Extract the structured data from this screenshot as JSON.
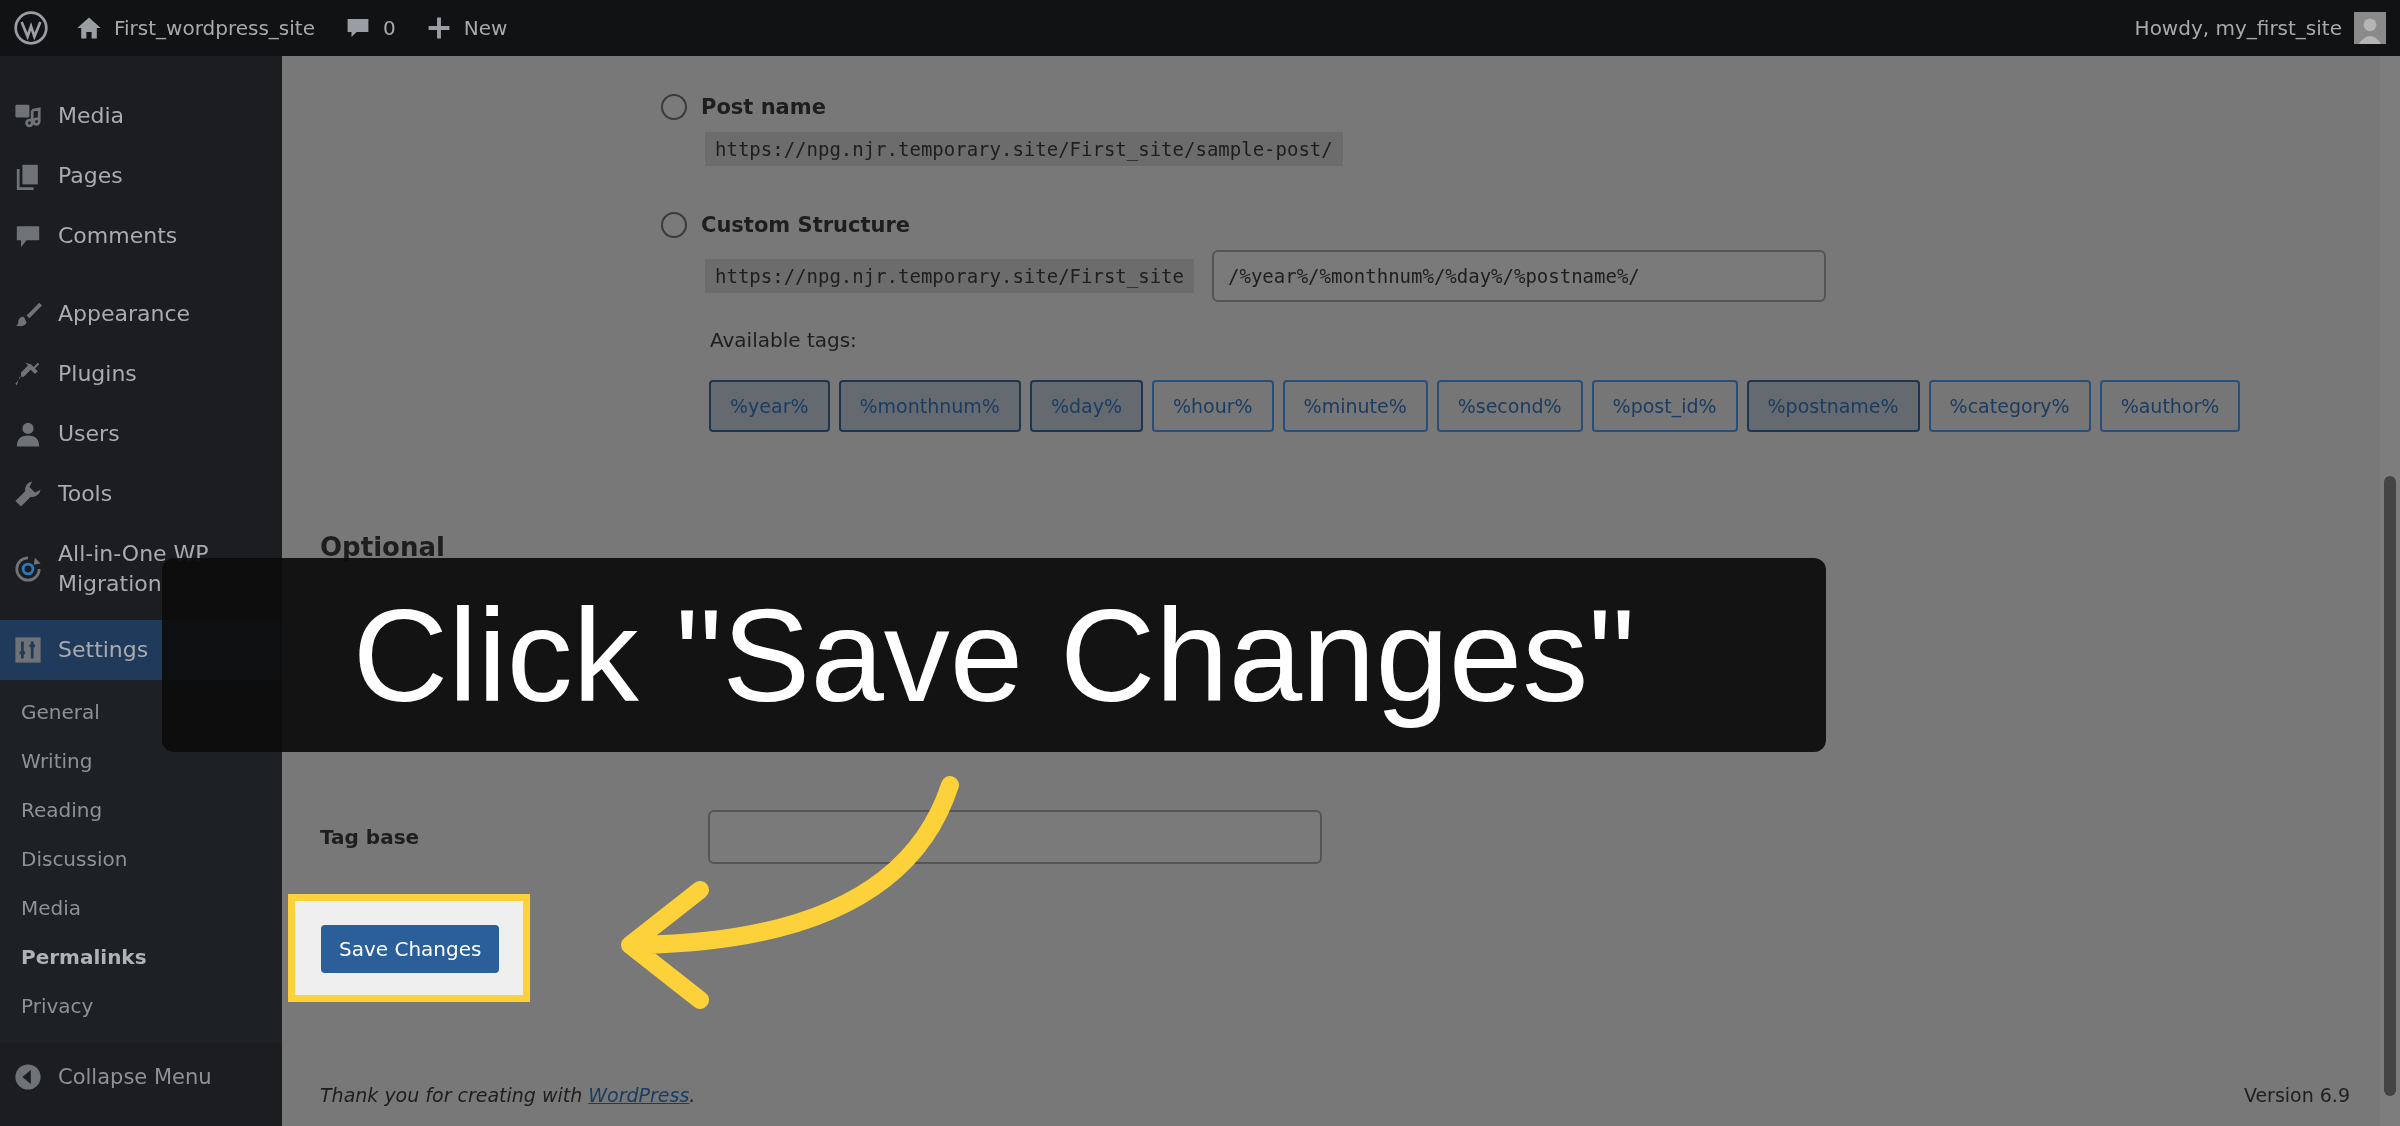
{
  "admin_bar": {
    "site_name": "First_wordpress_site",
    "comments_count": "0",
    "new_label": "New",
    "greeting": "Howdy, my_first_site"
  },
  "sidebar": {
    "items": [
      {
        "label": "Media",
        "kind": "media",
        "selected": false
      },
      {
        "label": "Pages",
        "kind": "pages",
        "selected": false
      },
      {
        "label": "Comments",
        "kind": "comments",
        "selected": false
      },
      {
        "label": "Appearance",
        "kind": "appearance",
        "selected": false
      },
      {
        "label": "Plugins",
        "kind": "plugins",
        "selected": false
      },
      {
        "label": "Users",
        "kind": "users",
        "selected": false
      },
      {
        "label": "Tools",
        "kind": "tools",
        "selected": false
      },
      {
        "label": "All-in-One WP Migration",
        "kind": "migration",
        "selected": false
      },
      {
        "label": "Settings",
        "kind": "settings",
        "selected": true
      }
    ],
    "submenu": [
      {
        "label": "General",
        "selected": false
      },
      {
        "label": "Writing",
        "selected": false
      },
      {
        "label": "Reading",
        "selected": false
      },
      {
        "label": "Discussion",
        "selected": false
      },
      {
        "label": "Media",
        "selected": false
      },
      {
        "label": "Permalinks",
        "selected": true
      },
      {
        "label": "Privacy",
        "selected": false
      }
    ],
    "collapse_label": "Collapse Menu"
  },
  "permalink_options": [
    {
      "label": "Post name",
      "selected": false,
      "example": "https://npg.njr.temporary.site/First_site/sample-post/"
    },
    {
      "label": "Custom Structure",
      "selected": false,
      "example": "https://npg.njr.temporary.site/First_site",
      "value": "/%year%/%monthnum%/%day%/%postname%/"
    }
  ],
  "available_tags": {
    "label": "Available tags:",
    "tags": [
      {
        "label": "%year%",
        "selected": true
      },
      {
        "label": "%monthnum%",
        "selected": true
      },
      {
        "label": "%day%",
        "selected": true
      },
      {
        "label": "%hour%",
        "selected": false
      },
      {
        "label": "%minute%",
        "selected": false
      },
      {
        "label": "%second%",
        "selected": false
      },
      {
        "label": "%post_id%",
        "selected": false
      },
      {
        "label": "%postname%",
        "selected": true
      },
      {
        "label": "%category%",
        "selected": false
      },
      {
        "label": "%author%",
        "selected": false
      }
    ]
  },
  "optional": {
    "heading": "Optional",
    "tag_base_label": "Tag base"
  },
  "save_button": "Save Changes",
  "footer": {
    "thanks": "Thank you for creating with ",
    "link": "WordPress",
    "suffix": ".",
    "version": "Version 6.9"
  },
  "callout": {
    "text": "Click \"Save Changes\""
  }
}
